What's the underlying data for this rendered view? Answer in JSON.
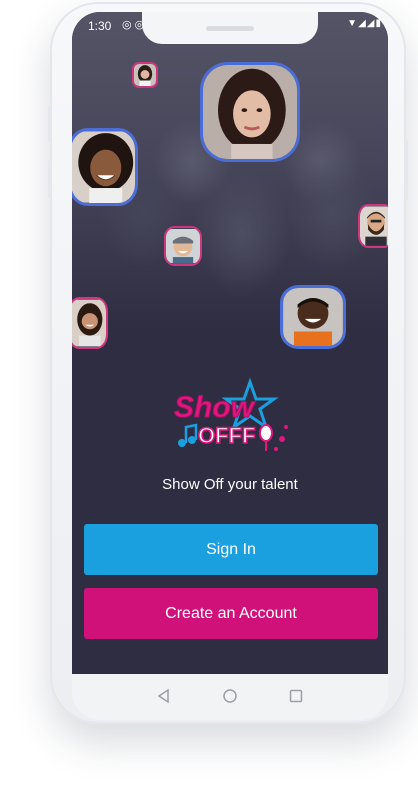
{
  "status_bar": {
    "time": "1:30",
    "left_icons": [
      "instagram-icon",
      "app-icon"
    ],
    "right_icons": [
      "wifi-icon",
      "signal-icon",
      "signal-icon",
      "battery-icon"
    ]
  },
  "logo": {
    "line1": "Show",
    "line2": "OFFF",
    "colors": {
      "pink": "#e0177f",
      "blue": "#1a9fdf"
    }
  },
  "tagline": "Show Off your talent",
  "buttons": {
    "sign_in": "Sign In",
    "create_account": "Create an Account"
  },
  "colors": {
    "screen_bg": "#2e2d42",
    "sign_in": "#1a9fdf",
    "create_account": "#d1117a",
    "avatar_border_blue": "#4a6dd8",
    "avatar_border_pink": "#d0357f"
  },
  "nav_bar": [
    "back-icon",
    "home-icon",
    "recents-icon"
  ]
}
